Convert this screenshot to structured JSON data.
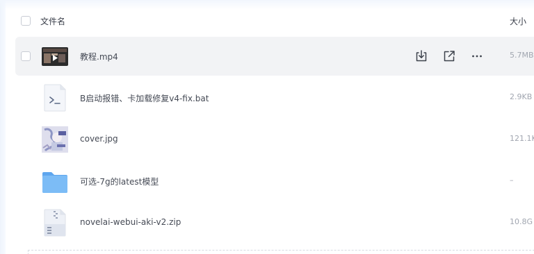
{
  "header": {
    "name_label": "文件名",
    "size_label": "大小"
  },
  "files": [
    {
      "name": "教程.mp4",
      "size": "5.7MB",
      "icon": "video-thumbnail"
    },
    {
      "name": "B启动报错、卡加载修复v4-fix.bat",
      "size": "2.9KB",
      "icon": "script-file-icon"
    },
    {
      "name": "cover.jpg",
      "size": "121.1K",
      "icon": "image-thumbnail"
    },
    {
      "name": "可选-7g的latest模型",
      "size": "–",
      "icon": "folder-icon"
    },
    {
      "name": "novelai-webui-aki-v2.zip",
      "size": "10.8G",
      "icon": "zip-file-icon"
    }
  ],
  "row_actions": [
    "download-icon",
    "share-icon",
    "more-icon"
  ],
  "colors": {
    "hover_row": "#f2f3f5",
    "folder": "#6fb2f2",
    "text": "#454a55",
    "muted": "#a1a6b0"
  }
}
